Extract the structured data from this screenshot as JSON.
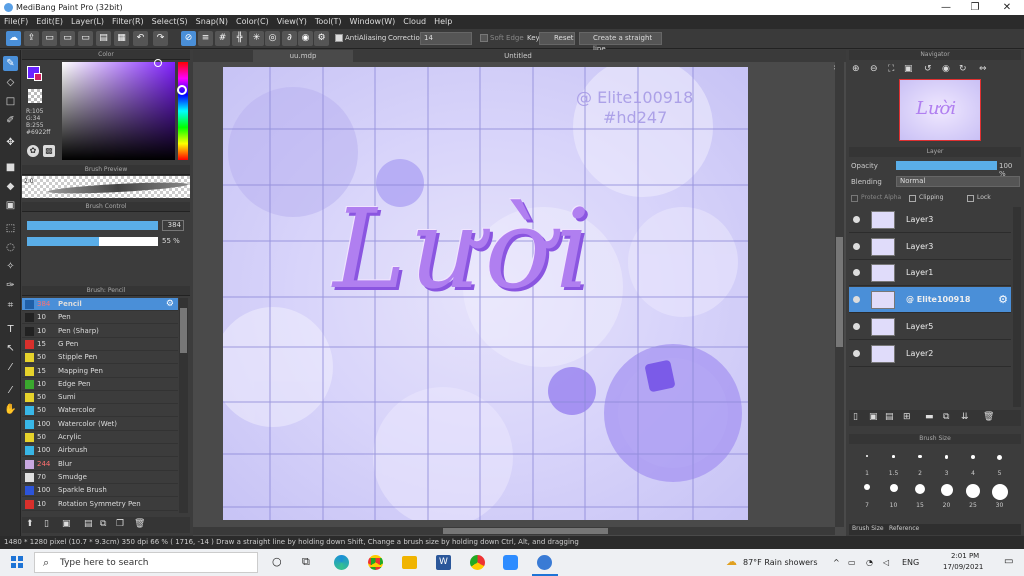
{
  "window": {
    "title": "MediBang Paint Pro (32bit)",
    "minimize": "—",
    "maximize": "❐",
    "close": "✕"
  },
  "menu": [
    "File(F)",
    "Edit(E)",
    "Layer(L)",
    "Filter(R)",
    "Select(S)",
    "Snap(N)",
    "Color(C)",
    "View(Y)",
    "Tool(T)",
    "Window(W)",
    "Cloud",
    "Help"
  ],
  "toolbar": {
    "antialiasing": "AntiAliasing",
    "correction_label": "Correction",
    "correction_value": "14",
    "soft_edge": "Soft Edge",
    "key": "Key",
    "reset": "Reset",
    "straight_line": "Create a straight line"
  },
  "color_panel": {
    "title": "Color",
    "r": "R:105",
    "g": "G:34",
    "b": "B:255",
    "hex": "#6922ff",
    "primary_color": "#6922ff"
  },
  "brush_preview": {
    "title": "Brush Preview",
    "size": "2.0"
  },
  "brush_control": {
    "title": "Brush Control",
    "size": "384",
    "opacity": "55 %",
    "size_fill": 1.0,
    "opacity_fill": 0.55
  },
  "brush_panel": {
    "title": "Brush: Pencil",
    "items": [
      {
        "size": "384",
        "name": "Pencil",
        "color": "#1f5fa8"
      },
      {
        "size": "10",
        "name": "Pen",
        "color": "#222222"
      },
      {
        "size": "10",
        "name": "Pen (Sharp)",
        "color": "#222222"
      },
      {
        "size": "15",
        "name": "G Pen",
        "color": "#d9302c"
      },
      {
        "size": "50",
        "name": "Stipple Pen",
        "color": "#e6d22b"
      },
      {
        "size": "15",
        "name": "Mapping Pen",
        "color": "#e6d22b"
      },
      {
        "size": "10",
        "name": "Edge Pen",
        "color": "#3aa82e"
      },
      {
        "size": "50",
        "name": "Sumi",
        "color": "#e6d22b"
      },
      {
        "size": "50",
        "name": "Watercolor",
        "color": "#38b6e6"
      },
      {
        "size": "100",
        "name": "Watercolor (Wet)",
        "color": "#38b6e6"
      },
      {
        "size": "50",
        "name": "Acrylic",
        "color": "#e6d22b"
      },
      {
        "size": "100",
        "name": "Airbrush",
        "color": "#38b6e6"
      },
      {
        "size": "244",
        "name": "Blur",
        "color": "#c8a8e0"
      },
      {
        "size": "70",
        "name": "Smudge",
        "color": "#e0e0e0"
      },
      {
        "size": "100",
        "name": "Sparkle Brush",
        "color": "#2c54d9"
      },
      {
        "size": "10",
        "name": "Rotation Symmetry Pen",
        "color": "#d9302c"
      }
    ]
  },
  "canvas": {
    "tab_file": "uu.mdp",
    "tab_untitled": "Untitled",
    "watermark_1": "@ Elite100918",
    "watermark_2": "#hd247",
    "lettering": "Lười"
  },
  "navigator": {
    "title": "Navigator"
  },
  "layer_panel": {
    "title": "Layer",
    "opacity_label": "Opacity",
    "opacity_value": "100 %",
    "blending_label": "Blending",
    "blending_value": "Normal",
    "protect_alpha": "Protect Alpha",
    "clipping": "Clipping",
    "lock": "Lock",
    "layers": [
      {
        "name": "Layer3"
      },
      {
        "name": "Layer3"
      },
      {
        "name": "Layer1"
      },
      {
        "name": "@ Elite100918"
      },
      {
        "name": "Layer5"
      },
      {
        "name": "Layer2"
      }
    ]
  },
  "brush_size_panel": {
    "title": "Brush Size",
    "row1": [
      "1",
      "1.5",
      "2",
      "3",
      "4",
      "5"
    ],
    "row2": [
      "7",
      "10",
      "15",
      "20",
      "25",
      "30"
    ],
    "tab_brush_size": "Brush Size",
    "tab_reference": "Reference"
  },
  "status": {
    "text": "1480 * 1280 pixel  (10.7 * 9.3cm)  350 dpi  66 %  ( 1716, -14 )  Draw a straight line by holding down Shift, Change a brush size by holding down Ctrl, Alt, and dragging"
  },
  "taskbar": {
    "search_placeholder": "Type here to search",
    "weather": "87°F  Rain showers",
    "lang": "ENG",
    "time": "2:01 PM",
    "date": "17/09/2021"
  }
}
